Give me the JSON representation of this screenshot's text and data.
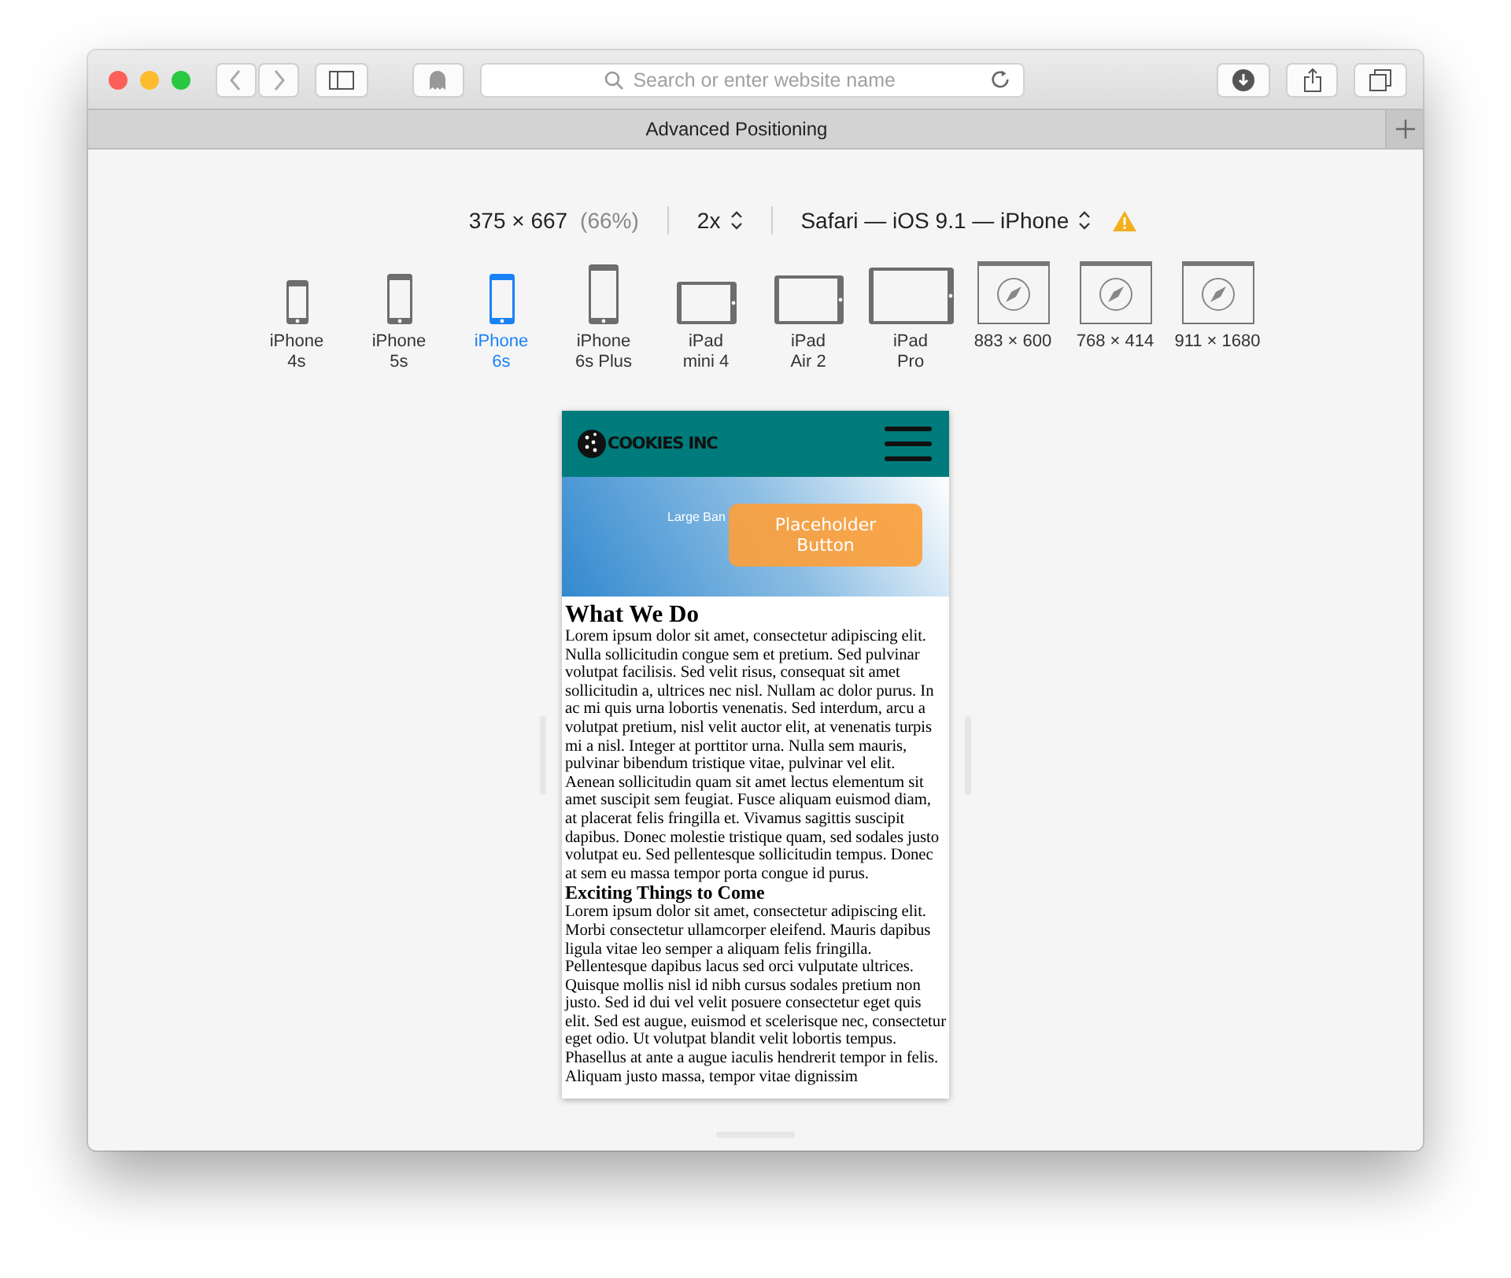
{
  "toolbar": {
    "address_placeholder": "Search or enter website name"
  },
  "tab_bar": {
    "tabs": [
      {
        "title": "Advanced Positioning",
        "selected": true
      }
    ]
  },
  "responsive_bar": {
    "dimensions": "375 × 667",
    "zoom": "(66%)",
    "scale": "2x",
    "user_agent": "Safari — iOS 9.1 — iPhone",
    "warning": true
  },
  "devices": [
    {
      "kind": "smallphone",
      "lines": [
        "iPhone",
        "4s"
      ],
      "selected": false
    },
    {
      "kind": "phone",
      "lines": [
        "iPhone",
        "5s"
      ],
      "selected": false
    },
    {
      "kind": "phone",
      "lines": [
        "iPhone",
        "6s"
      ],
      "selected": true
    },
    {
      "kind": "largephone",
      "lines": [
        "iPhone",
        "6s Plus"
      ],
      "selected": false
    },
    {
      "kind": "smalltablet",
      "lines": [
        "iPad",
        "mini 4"
      ],
      "selected": false
    },
    {
      "kind": "tablet",
      "lines": [
        "iPad",
        "Air 2"
      ],
      "selected": false
    },
    {
      "kind": "largetablet",
      "lines": [
        "iPad",
        "Pro"
      ],
      "selected": false
    },
    {
      "kind": "window",
      "lines": [
        "883 × 600"
      ],
      "selected": false
    },
    {
      "kind": "window",
      "lines": [
        "768 × 414"
      ],
      "selected": false
    },
    {
      "kind": "window",
      "lines": [
        "911 × 1680"
      ],
      "selected": false
    }
  ],
  "preview": {
    "logo": "COOKIES INC",
    "banner_text": "Large Ban",
    "banner_button": "Placeholder Button",
    "sections": [
      {
        "heading": "What We Do",
        "kind": "title",
        "text": "Lorem ipsum dolor sit amet, consectetur adipiscing elit. Nulla sollicitudin congue sem et pretium. Sed pulvinar volutpat facilisis. Sed velit risus, consequat sit amet sollicitudin a, ultrices nec nisl. Nullam ac dolor purus. In ac mi quis urna lobortis venenatis. Sed interdum, arcu a volutpat pretium, nisl velit auctor elit, at venenatis turpis mi a nisl. Integer at porttitor urna. Nulla sem mauris, pulvinar bibendum tristique vitae, pulvinar vel elit. Aenean sollicitudin quam sit amet lectus elementum sit amet suscipit sem feugiat. Fusce aliquam euismod diam, at placerat felis fringilla et. Vivamus sagittis suscipit dapibus. Donec molestie tristique quam, sed sodales justo volutpat eu. Sed pellentesque sollicitudin tempus. Donec at sem eu massa tempor porta congue id purus."
      },
      {
        "heading": "Exciting Things to Come",
        "kind": "subtitle",
        "text": "Lorem ipsum dolor sit amet, consectetur adipiscing elit. Morbi consectetur ullamcorper eleifend. Mauris dapibus ligula vitae leo semper a aliquam felis fringilla. Pellentesque dapibus lacus sed orci vulputate ultrices. Quisque mollis nisl id nibh cursus sodales pretium non justo. Sed id dui vel velit posuere consectetur eget quis elit. Sed est augue, euismod et scelerisque nec, consectetur eget odio. Ut volutpat blandit velit lobortis tempus. Phasellus at ante a augue iaculis hendrerit tempor in felis. Aliquam justo massa, tempor vitae dignissim"
      }
    ]
  }
}
